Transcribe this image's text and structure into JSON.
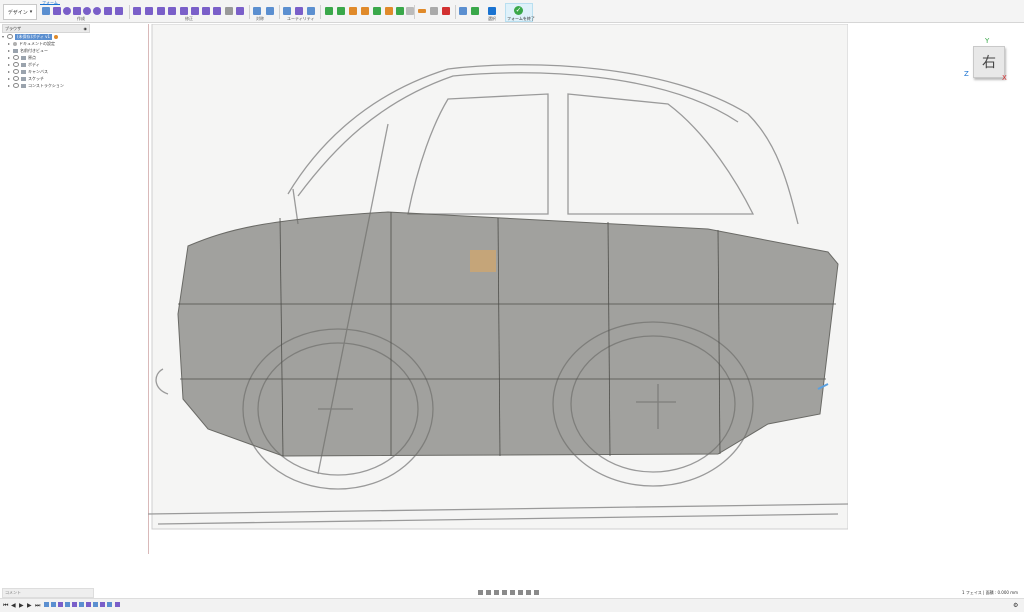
{
  "toolbar": {
    "workspace_label": "デザイン",
    "tabs": [
      {
        "label": "フォーム"
      }
    ],
    "groups": {
      "create": "作成",
      "modify": "修正",
      "symmetry": "対称",
      "utilities": "ユーティリティ",
      "select": "選択",
      "finish": "フォームを終了"
    },
    "colors": {
      "accent": "#1a73d1",
      "tool_purple": "#7a5fc9",
      "finish_check": "#3aa84a"
    }
  },
  "browser": {
    "header": "ブラウザ",
    "items": [
      {
        "label": "(未保存)ボディ v1"
      },
      {
        "label": "ドキュメントの設定"
      },
      {
        "label": "名前付きビュー"
      },
      {
        "label": "原点"
      },
      {
        "label": "ボディ"
      },
      {
        "label": "キャンバス"
      },
      {
        "label": "スケッチ"
      },
      {
        "label": "コンストラクション"
      }
    ]
  },
  "viewcube": {
    "face": "右",
    "axes": {
      "y": "Y",
      "z": "Z",
      "x": "X"
    }
  },
  "status": {
    "comments": "コメント",
    "right": "1 フェイス | 面積 : 0.000 mm"
  }
}
